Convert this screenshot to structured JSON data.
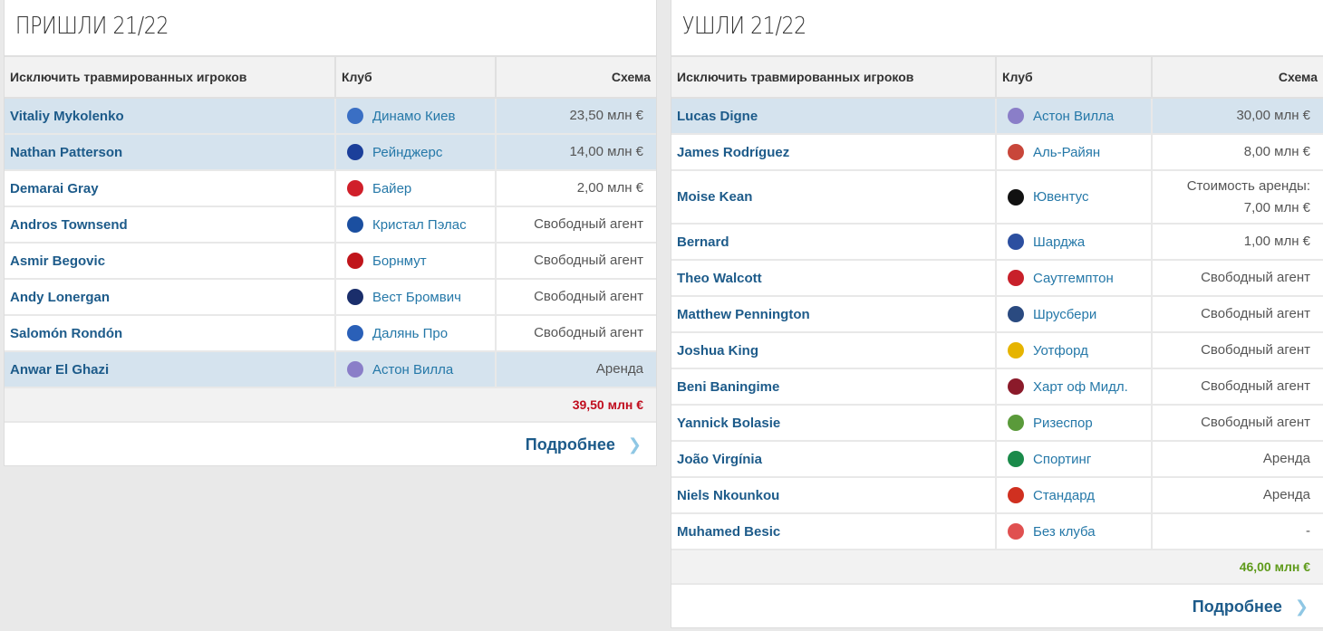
{
  "colors": {
    "neg_total": "#c00d1e",
    "pos_total": "#5e9a1a",
    "link": "#1d5b8a"
  },
  "left": {
    "title": "ПРИШЛИ 21/22",
    "headers": [
      "Исключить травмированных игроков",
      "Клуб",
      "Схема"
    ],
    "rows": [
      {
        "player": "Vitaliy Mykolenko",
        "club": "Динамо Киев",
        "value": "23,50 млн €",
        "hl": true,
        "icon": "#3a6fc4"
      },
      {
        "player": "Nathan Patterson",
        "club": "Рейнджерс",
        "value": "14,00 млн €",
        "hl": true,
        "icon": "#1b3f9a"
      },
      {
        "player": "Demarai Gray",
        "club": "Байер",
        "value": "2,00 млн €",
        "icon": "#d01f2a"
      },
      {
        "player": "Andros Townsend",
        "club": "Кристал Пэлас",
        "value": "Свободный агент",
        "icon": "#1b4fa0"
      },
      {
        "player": "Asmir Begovic",
        "club": "Борнмут",
        "value": "Свободный агент",
        "icon": "#c0151b"
      },
      {
        "player": "Andy Lonergan",
        "club": "Вест Бромвич",
        "value": "Свободный агент",
        "icon": "#1a2e6b"
      },
      {
        "player": "Salomón Rondón",
        "club": "Далянь Про",
        "value": "Свободный агент",
        "icon": "#2a60b8"
      },
      {
        "player": "Anwar El Ghazi",
        "club": "Астон Вилла",
        "value": "Аренда",
        "hl": true,
        "icon": "#8a7ec8"
      }
    ],
    "total": "39,50 млн €",
    "more": "Подробнее"
  },
  "right": {
    "title": "УШЛИ 21/22",
    "headers": [
      "Исключить травмированных игроков",
      "Клуб",
      "Схема"
    ],
    "rows": [
      {
        "player": "Lucas Digne",
        "club": "Астон Вилла",
        "value": "30,00 млн €",
        "hl": true,
        "icon": "#8a7ec8"
      },
      {
        "player": "James Rodríguez",
        "club": "Аль-Райян",
        "value": "8,00 млн €",
        "icon": "#c8463a"
      },
      {
        "player": "Moise Kean",
        "club": "Ювентус",
        "value": "Стоимость аренды:",
        "value2": "7,00 млн €",
        "tall": true,
        "icon": "#111111"
      },
      {
        "player": "Bernard",
        "club": "Шарджа",
        "value": "1,00 млн €",
        "icon": "#2c4fa0"
      },
      {
        "player": "Theo Walcott",
        "club": "Саутгемптон",
        "value": "Свободный агент",
        "icon": "#c8202a"
      },
      {
        "player": "Matthew Pennington",
        "club": "Шрусбери",
        "value": "Свободный агент",
        "icon": "#2a4a80"
      },
      {
        "player": "Joshua King",
        "club": "Уотфорд",
        "value": "Свободный агент",
        "icon": "#e6b400"
      },
      {
        "player": "Beni Baningime",
        "club": "Харт оф Мидл.",
        "value": "Свободный агент",
        "icon": "#8b1a2a"
      },
      {
        "player": "Yannick Bolasie",
        "club": "Ризеспор",
        "value": "Свободный агент",
        "icon": "#5a9a3a"
      },
      {
        "player": "João Virgínia",
        "club": "Спортинг",
        "value": "Аренда",
        "icon": "#1a8a4a"
      },
      {
        "player": "Niels Nkounkou",
        "club": "Стандард",
        "value": "Аренда",
        "icon": "#d03020"
      },
      {
        "player": "Muhamed Besic",
        "club": "Без клуба",
        "value": "-",
        "icon": "#e05050"
      }
    ],
    "total": "46,00 млн €",
    "more": "Подробнее"
  }
}
